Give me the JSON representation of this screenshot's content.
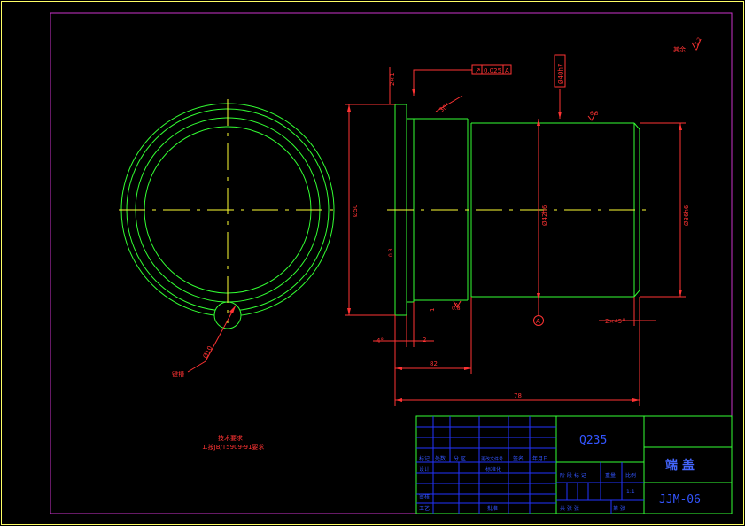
{
  "colors": {
    "background": "#000000",
    "outer_border": "#ffff66",
    "inner_border": "#cc33cc",
    "part_outline": "#33ff33",
    "centerline": "#ffff33",
    "dimension": "#ff3333",
    "title_block_grid": "#2233ff",
    "title_block_frame": "#33ff33",
    "title_text": "#4466ff",
    "material_text": "#3355ff"
  },
  "annotations": {
    "roughness_rest": "其余",
    "roughness_rest_value": "3.2",
    "roughness_top": "6.3",
    "roughness_face": "6.3",
    "roughness_bore": "0.8",
    "roughness_flange": "0.8",
    "roughness_left": "3.2",
    "tolerance_symbol": "↗",
    "tolerance_value": "0.025",
    "tolerance_datum": "A",
    "datum_bubble": "A",
    "datum_label_bottom": "A",
    "chamfer_top": "2×1",
    "angle_top": "30°",
    "chamfer_right": "2×45°",
    "chamfer_left": "4°",
    "dim_2": "2",
    "dim_1": "1",
    "dim_82": "82",
    "dim_78": "78",
    "dim_d50": "Ø50",
    "dim_d42": "Ø42h6",
    "dim_d36": "Ø36h6",
    "vertical_tag": "Ø40h7",
    "dim_circle_small": "Ø10",
    "label_key": "键槽"
  },
  "technical_requirements": {
    "title": "技术要求",
    "line1": "1.按JB/T5909-91要求"
  },
  "title_block": {
    "material": "Q235",
    "part_name": "端  盖",
    "drawing_no": "JJM-06",
    "row_labels": [
      "标记",
      "处数",
      "分  区",
      "更改文件号",
      "签名",
      "年月日"
    ],
    "design": "设计",
    "standardize": "标准化",
    "review": "审核",
    "process": "工艺",
    "approve": "批准",
    "stage_labels": [
      "阶 段 标 记",
      "重量",
      "比例"
    ],
    "scale": "1:1",
    "sheets_total": "共  张 张",
    "sheet_no": "第  张"
  }
}
